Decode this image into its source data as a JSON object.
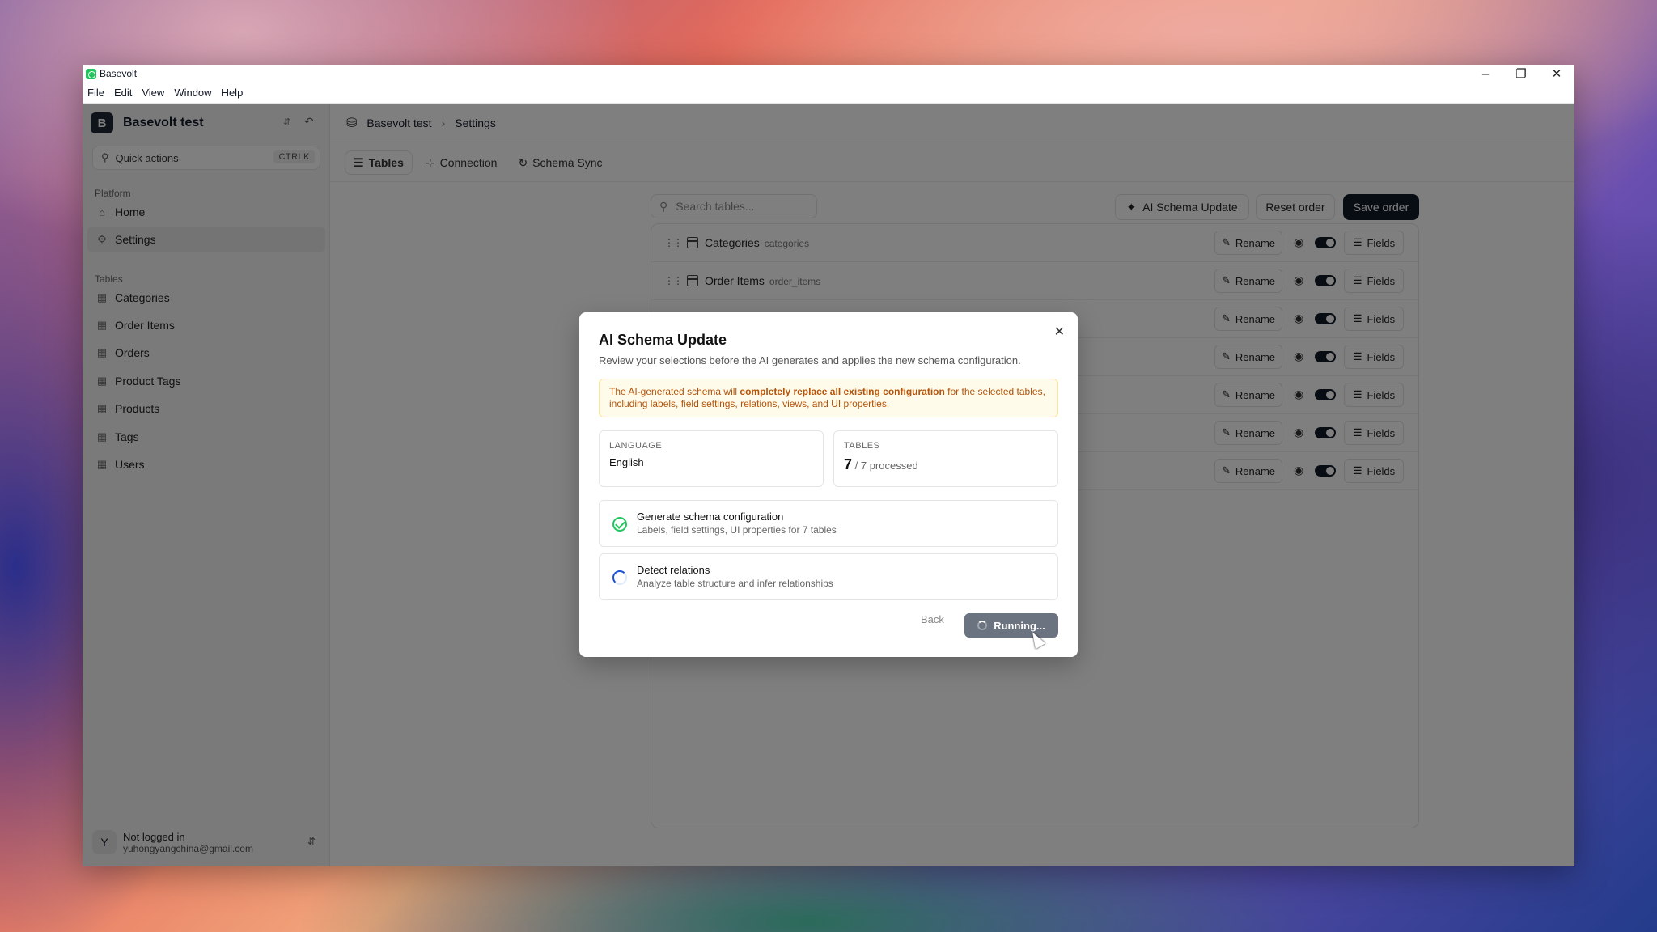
{
  "window": {
    "title": "Basevolt"
  },
  "menu": [
    "File",
    "Edit",
    "View",
    "Window",
    "Help"
  ],
  "sidebar": {
    "workspace_initial": "B",
    "workspace_name": "Basevolt test",
    "quick_actions": "Quick actions",
    "shortcut": "CTRLK",
    "platform_label": "Platform",
    "platform_items": [
      "Home",
      "Settings"
    ],
    "tables_label": "Tables",
    "tables": [
      "Categories",
      "Order Items",
      "Orders",
      "Product Tags",
      "Products",
      "Tags",
      "Users"
    ],
    "user": {
      "initial": "Y",
      "status": "Not logged in",
      "email": "yuhongyangchina@gmail.com"
    }
  },
  "breadcrumb": [
    "Basevolt test",
    "Settings"
  ],
  "tabs": [
    "Tables",
    "Connection",
    "Schema Sync"
  ],
  "toolbar": {
    "search_placeholder": "Search tables...",
    "ai_button": "AI Schema Update",
    "reset": "Reset order",
    "save": "Save order"
  },
  "rows": [
    {
      "name": "Categories",
      "slug": "categories"
    },
    {
      "name": "Order Items",
      "slug": "order_items"
    },
    {
      "name": "",
      "slug": ""
    },
    {
      "name": "",
      "slug": ""
    },
    {
      "name": "",
      "slug": ""
    },
    {
      "name": "",
      "slug": ""
    },
    {
      "name": "",
      "slug": ""
    }
  ],
  "row_actions": {
    "rename": "Rename",
    "fields": "Fields"
  },
  "modal": {
    "title": "AI Schema Update",
    "description": "Review your selections before the AI generates and applies the new schema configuration.",
    "warning_pre": "The AI-generated schema will ",
    "warning_bold": "completely replace all existing configuration",
    "warning_post": " for the selected tables, including labels, field settings, relations, views, and UI properties.",
    "language_label": "LANGUAGE",
    "language_value": "English",
    "tables_label": "TABLES",
    "tables_count": "7",
    "tables_processed": "/ 7 processed",
    "steps": [
      {
        "title": "Generate schema configuration",
        "subtitle": "Labels, field settings, UI properties for 7 tables",
        "status": "done"
      },
      {
        "title": "Detect relations",
        "subtitle": "Analyze table structure and infer relationships",
        "status": "running"
      }
    ],
    "back": "Back",
    "running": "Running..."
  }
}
